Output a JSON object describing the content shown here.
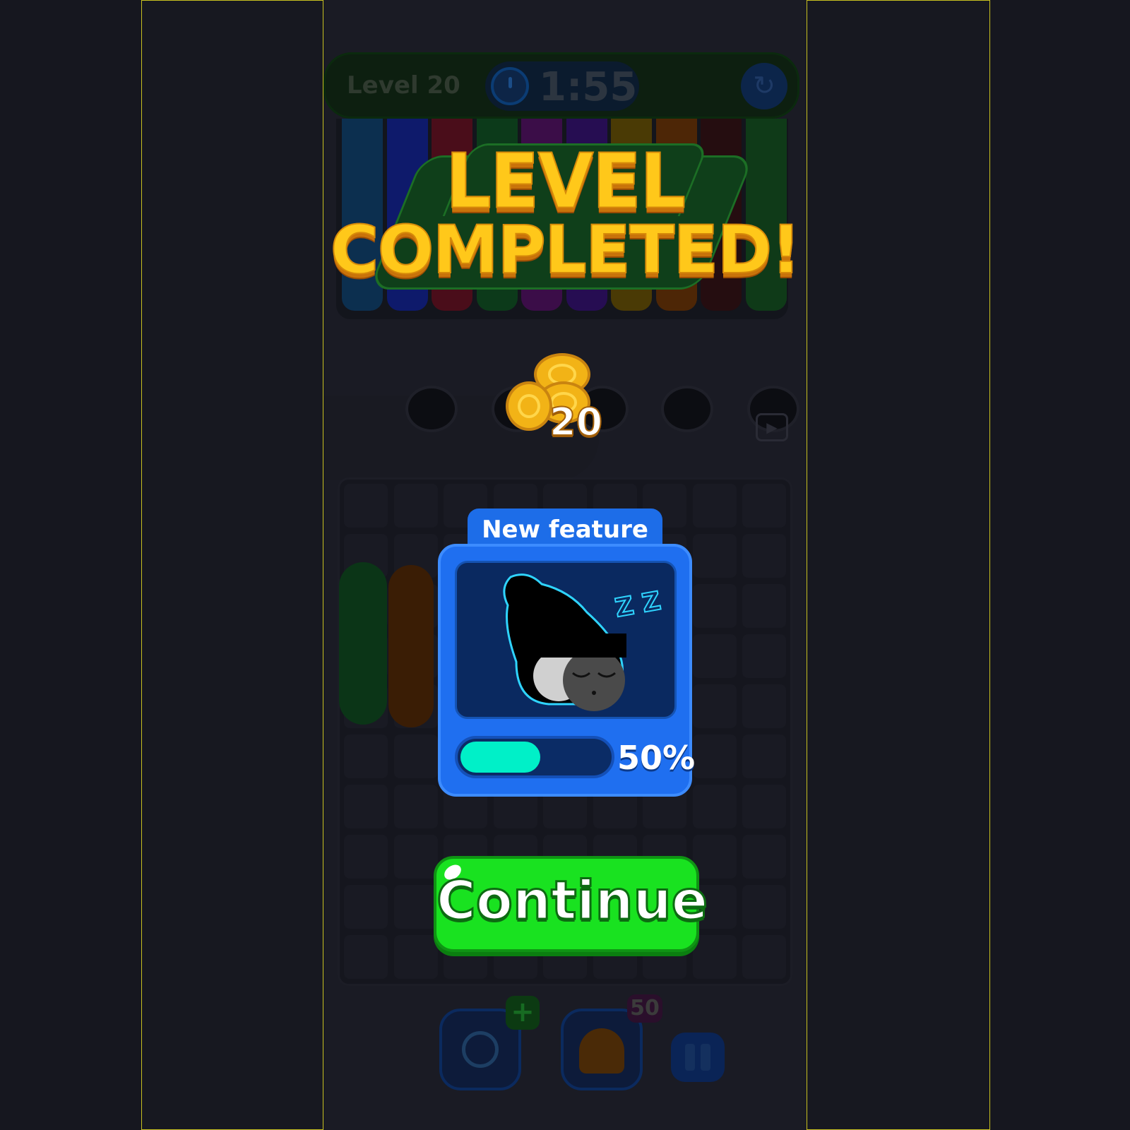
{
  "hud": {
    "level_label": "Level 20",
    "timer": "1:55",
    "restart_icon": "restart-icon",
    "timer_icon": "stopwatch-icon"
  },
  "banner": {
    "line1": "LEVEL",
    "line2": "COMPLETED!"
  },
  "reward": {
    "coin_icon": "coin-stack-icon",
    "amount": "20"
  },
  "feature": {
    "tab_label": "New feature",
    "preview_icon": "sleeping-creature-icon",
    "zzz": "Z Z",
    "progress_percent": 50,
    "progress_label": "50%"
  },
  "continue": {
    "label": "Continue"
  },
  "boosters": {
    "time_icon": "clock-icon",
    "add_badge": "+",
    "ghost_icon": "ghost-icon",
    "count_badge": "50",
    "pause_icon": "pause-icon",
    "video_icon": "video-play-icon"
  },
  "colors": {
    "title": "#ffc81a",
    "continue": "#19e220",
    "feature_card": "#1f6ff0",
    "progress_fill": "#00f0c8",
    "tubes": [
      "#0c2f4f",
      "#0e1a6b",
      "#4a0d1a",
      "#0c3a1a",
      "#3b0d48",
      "#260d52",
      "#4a3a05",
      "#4d2606",
      "#250d10",
      "#0f3a18"
    ]
  }
}
